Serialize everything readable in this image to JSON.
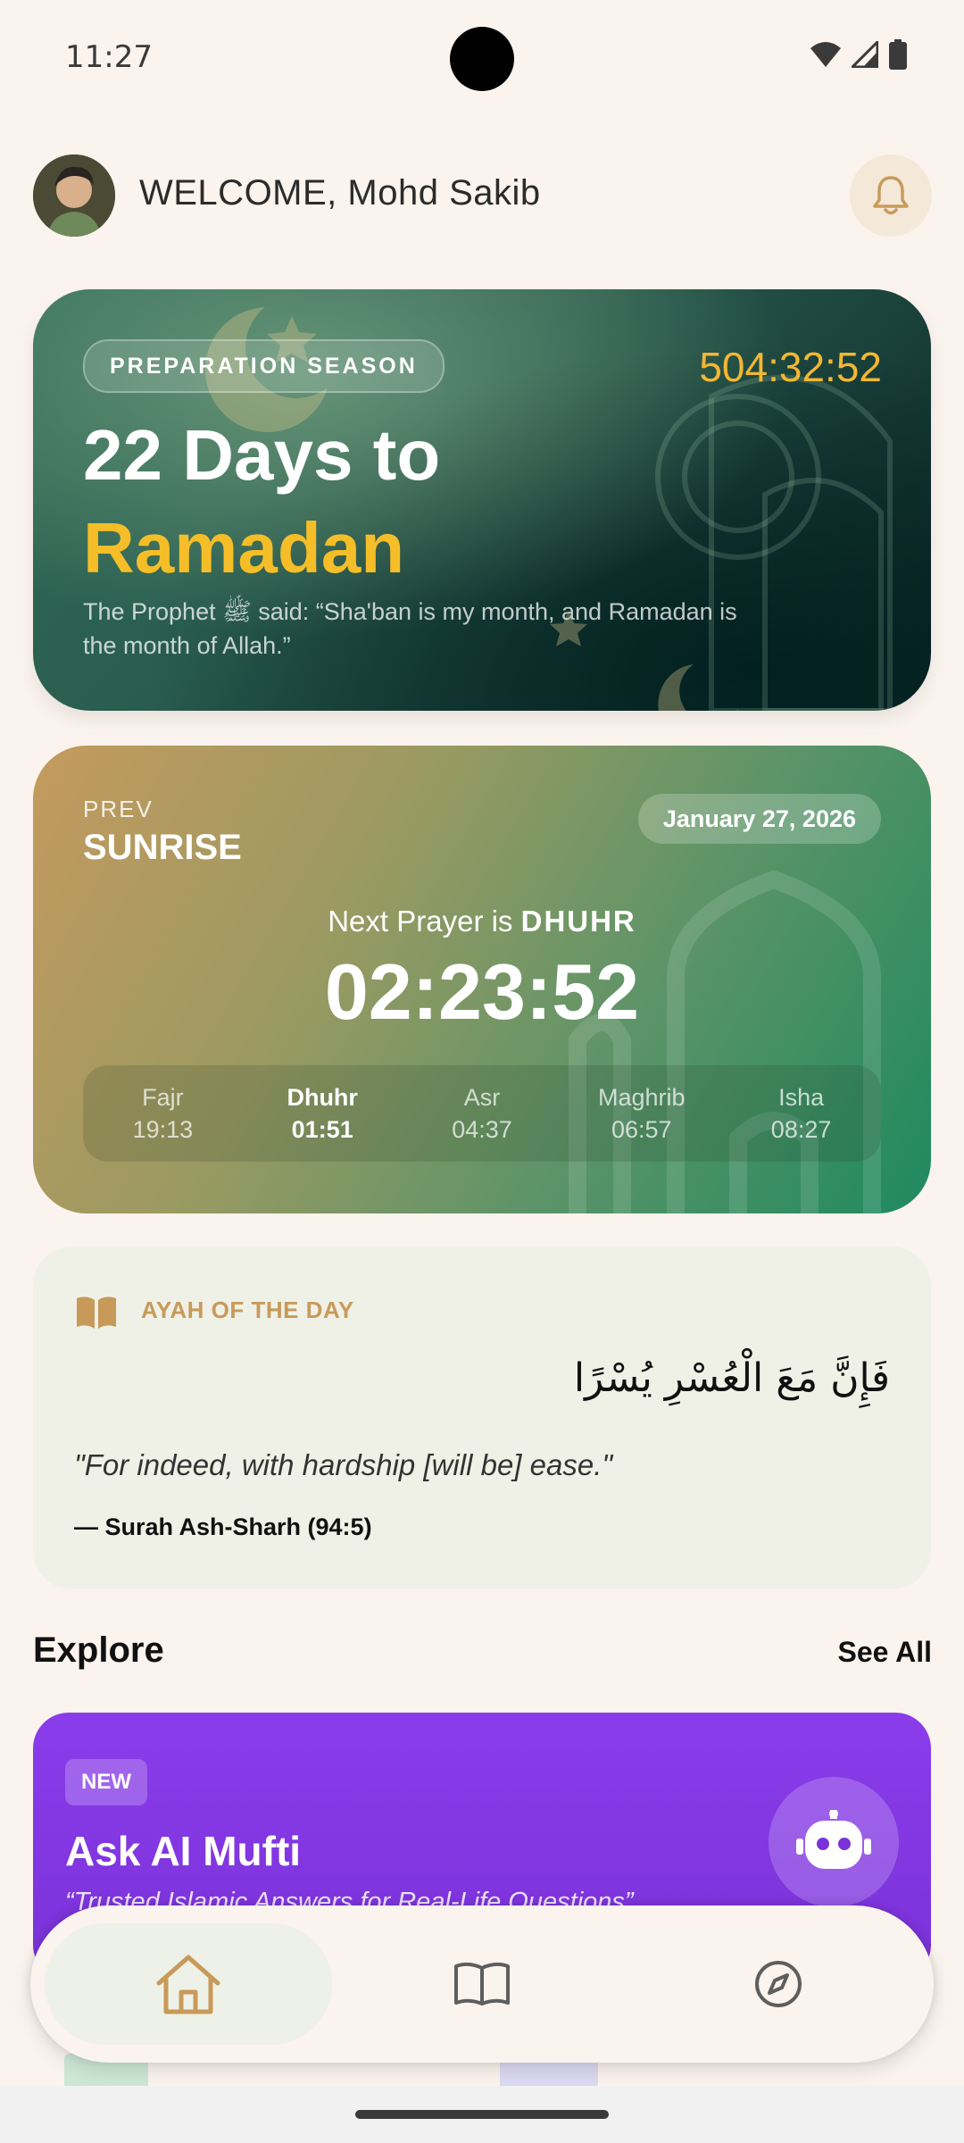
{
  "status_bar": {
    "time": "11:27"
  },
  "header": {
    "welcome": "WELCOME, Mohd Sakib"
  },
  "ramadan_card": {
    "badge": "PREPARATION SEASON",
    "countdown": "504:32:52",
    "title_line1": "22 Days to",
    "title_line2": "Ramadan",
    "quote": "The Prophet ﷺ said: “Sha'ban is my month, and Ramadan is the month of Allah.”"
  },
  "prayer_card": {
    "prev_label": "PREV",
    "prev_name": "SUNRISE",
    "date": "January 27, 2026",
    "next_prefix": "Next Prayer is ",
    "next_name": "DHUHR",
    "next_countdown": "02:23:52",
    "times": [
      {
        "name": "Fajr",
        "time": "19:13",
        "active": false
      },
      {
        "name": "Dhuhr",
        "time": "01:51",
        "active": true
      },
      {
        "name": "Asr",
        "time": "04:37",
        "active": false
      },
      {
        "name": "Maghrib",
        "time": "06:57",
        "active": false
      },
      {
        "name": "Isha",
        "time": "08:27",
        "active": false
      }
    ]
  },
  "ayah": {
    "heading": "AYAH OF THE DAY",
    "arabic": "فَإِنَّ مَعَ الْعُسْرِ يُسْرًا",
    "translation": "\"For indeed, with hardship [will be] ease.\"",
    "reference": "— Surah Ash-Sharh (94:5)"
  },
  "explore": {
    "title": "Explore",
    "see_all": "See All",
    "ai_card": {
      "badge": "NEW",
      "title": "Ask AI Mufti",
      "subtitle": "“Trusted Islamic Answers for Real-Life Questions”"
    }
  },
  "colors": {
    "background": "#FBF3ED",
    "gold": "#F5BE28",
    "accent_brown": "#C89A5A",
    "purple": "#8A3CEB"
  },
  "icons": {
    "bell": "bell-icon",
    "home": "home-icon",
    "book": "book-icon",
    "compass": "compass-icon",
    "robot": "robot-icon"
  }
}
